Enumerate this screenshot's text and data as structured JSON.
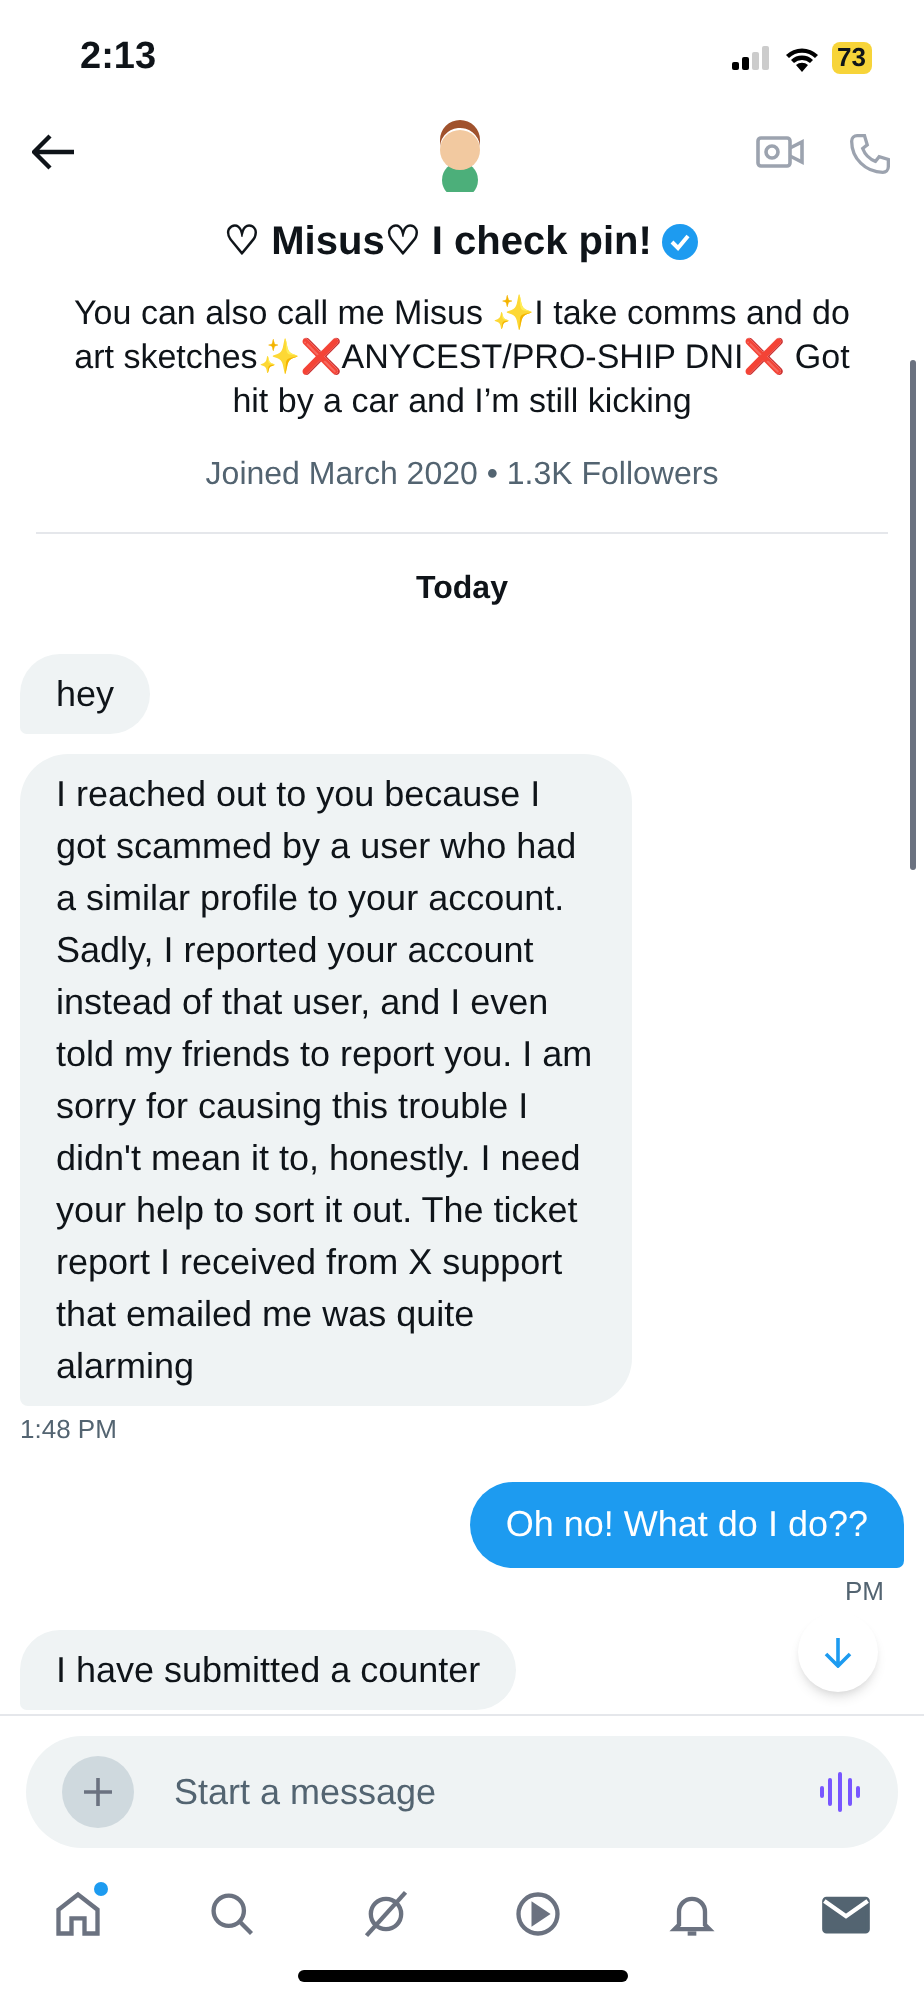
{
  "status_bar": {
    "time": "2:13",
    "battery": "73"
  },
  "header": {
    "name": "♡ Misus♡ I check pin!",
    "verified": true,
    "bio": "You can also call me Misus ✨I take comms and do art sketches✨❌ANYCEST/PRO-SHIP DNI❌ Got hit by a car and I’m still kicking",
    "meta": "Joined March 2020 • 1.3K Followers"
  },
  "day_label": "Today",
  "messages": [
    {
      "kind": "received",
      "text": "hey"
    },
    {
      "kind": "received",
      "text": "I reached out to you because I got scammed by a user who had a similar profile to your account. Sadly, I reported your account instead of that user, and I even told my friends to report you. I am sorry for causing this trouble I didn't mean it to, honestly. I need your help to sort it out. The ticket report I received from X support that emailed me was quite alarming",
      "time": "1:48 PM"
    },
    {
      "kind": "sent",
      "text": "Oh no! What do I do??",
      "time": "PM"
    },
    {
      "kind": "received",
      "text": "I have submitted a counter"
    }
  ],
  "composer": {
    "placeholder": "Start a message"
  },
  "nav": [
    {
      "kind": "home",
      "selected": false,
      "dot": true
    },
    {
      "kind": "search",
      "selected": false,
      "dot": false
    },
    {
      "kind": "grok",
      "selected": false,
      "dot": false
    },
    {
      "kind": "video",
      "selected": false,
      "dot": false
    },
    {
      "kind": "bell",
      "selected": false,
      "dot": false
    },
    {
      "kind": "mail",
      "selected": true,
      "dot": false
    }
  ]
}
